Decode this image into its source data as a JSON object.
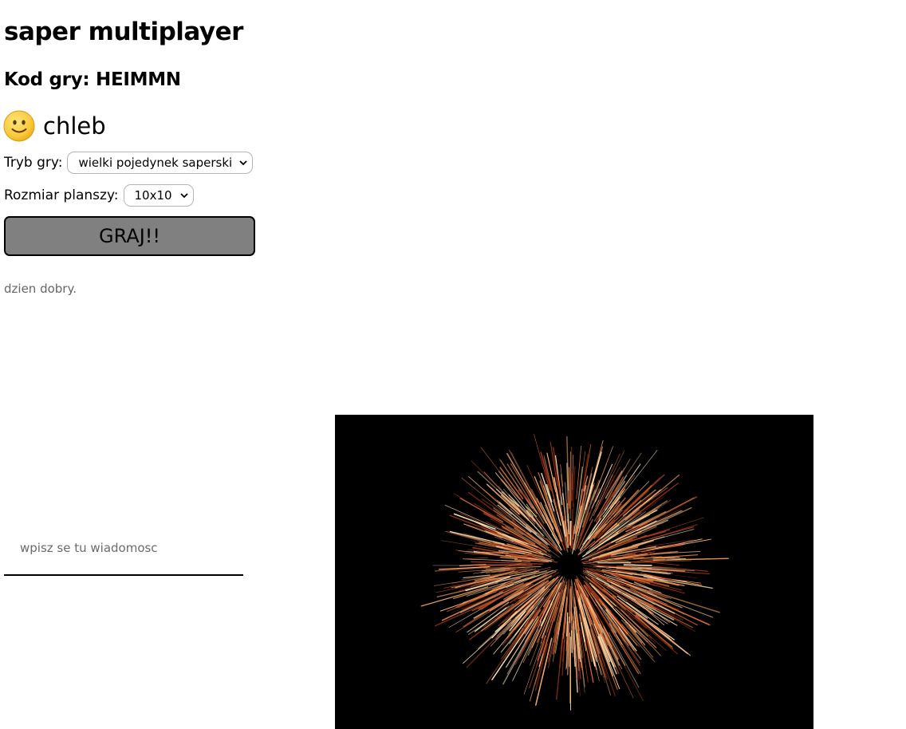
{
  "title": "saper multiplayer",
  "game_code": "Kod gry: HEIMMN",
  "player": {
    "avatar_icon": "slightly-smiling-face-emoji",
    "name": "chleb"
  },
  "game_mode": {
    "label": "Tryb gry:",
    "selected": "wielki pojedynek saperski"
  },
  "board_size": {
    "label": "Rozmiar planszy:",
    "selected": "10x10"
  },
  "play_button": "GRAJ!!",
  "status_message": "dzien dobry.",
  "chat": {
    "placeholder": "wpisz se tu wiadomosc"
  },
  "image": {
    "subject": "fireworks-burst",
    "background_color": "#000000",
    "spark_colors": [
      "#ffe6b8",
      "#ffb070",
      "#e07038",
      "#a83818"
    ]
  },
  "colors": {
    "button_bg": "#808080",
    "text_muted": "#666666"
  }
}
